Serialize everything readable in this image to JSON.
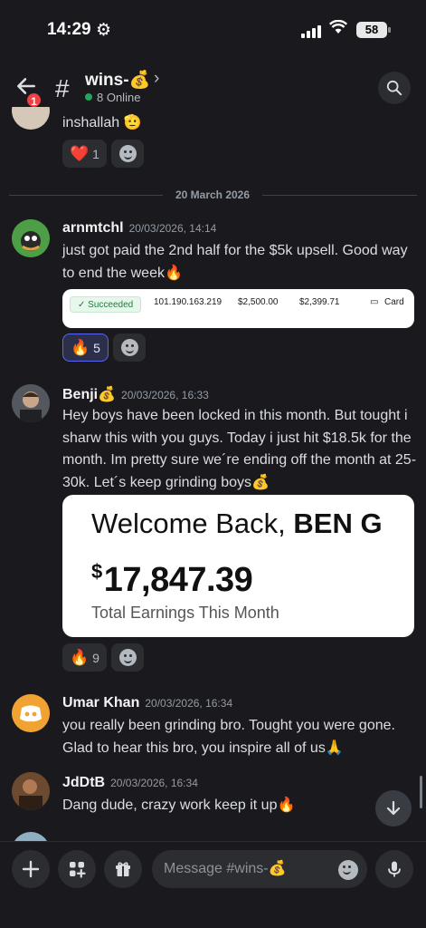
{
  "status": {
    "time": "14:29",
    "battery": "58"
  },
  "header": {
    "channel": "wins-💰",
    "online": "8 Online",
    "badge": "1"
  },
  "messages": {
    "m0": {
      "text": "inshallah 🫡",
      "reaction_emoji": "❤️",
      "reaction_count": "1"
    },
    "date_divider": "20 March 2026",
    "m1": {
      "author": "arnmtchl",
      "time": "20/03/2026, 14:14",
      "text": "just got paid the 2nd half for the $5k upsell. Good way to end the week🔥",
      "strip": {
        "status": "✓ Succeeded",
        "id": "101.190.163.219",
        "amount": "$2,500.00",
        "net": "$2,399.71",
        "method": "Card"
      },
      "reaction_emoji": "🔥",
      "reaction_count": "5"
    },
    "m2": {
      "author": "Benji💰",
      "time": "20/03/2026, 16:33",
      "text": "Hey boys have been locked in this month. But tought i sharw this with you guys. Today i just hit $18.5k for the month. Im pretty sure we´re ending off the month at 25-30k. Let´s keep grinding boys💰",
      "card": {
        "welcome": "Welcome Back, ",
        "name": "BEN G",
        "currency": "$",
        "amount": "17,847.39",
        "label": "Total Earnings This Month"
      },
      "reaction_emoji": "🔥",
      "reaction_count": "9"
    },
    "m3": {
      "author": "Umar Khan",
      "time": "20/03/2026, 16:34",
      "text": "you really been grinding bro. Tought you were gone. Glad to hear this bro, you inspire all of us🙏"
    },
    "m4": {
      "author": "JdDtB",
      "time": "20/03/2026, 16:34",
      "text": "Dang dude, crazy work keep it up🔥"
    }
  },
  "composer": {
    "placeholder": "Message #wins-💰"
  },
  "icons": {
    "back": "arrow-left-icon",
    "channel": "hash-icon",
    "search": "search-icon",
    "add": "plus-icon",
    "apps": "apps-icon",
    "gift": "gift-icon",
    "emoji": "smile-icon",
    "mic": "microphone-icon",
    "jump": "arrow-down-icon"
  },
  "colors": {
    "accent": "#5865f2",
    "online": "#23a55a",
    "badge": "#f23f43",
    "background": "#1a1a1e"
  }
}
